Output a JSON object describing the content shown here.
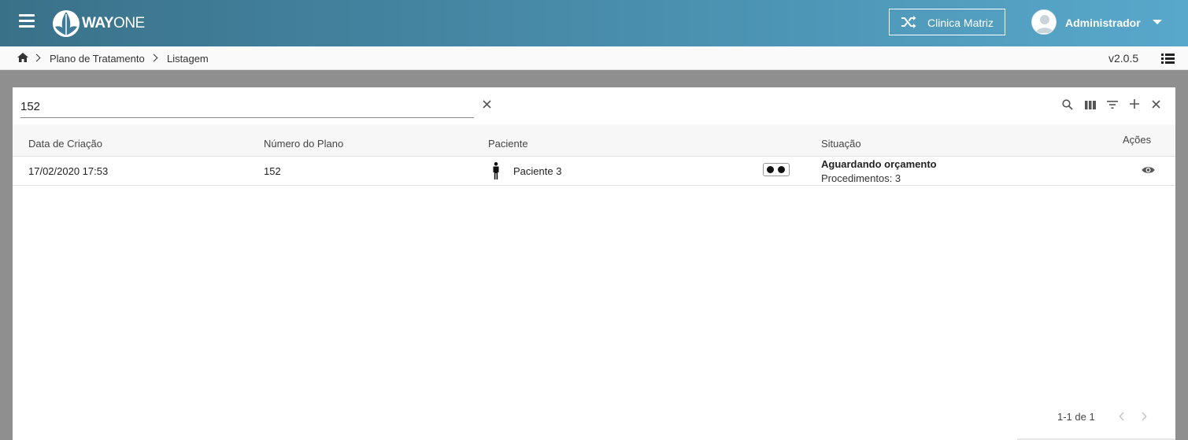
{
  "header": {
    "logo_text_bold": "WAY",
    "logo_text_light": "ONE",
    "clinic_button_label": "Clinica Matriz",
    "user_name": "Administrador"
  },
  "breadcrumb": {
    "items": [
      "Plano de Tratamento",
      "Listagem"
    ],
    "version": "v2.0.5"
  },
  "search": {
    "value": "152",
    "placeholder": ""
  },
  "table": {
    "columns": [
      "Data de Criação",
      "Número do Plano",
      "Paciente",
      "Situação",
      "Ações"
    ],
    "rows": [
      {
        "date": "17/02/2020 17:53",
        "plan_number": "152",
        "patient": "Paciente 3",
        "status": "Aguardando orçamento",
        "procedures": "Procedimentos: 3"
      }
    ]
  },
  "pagination": {
    "range_text": "1-1 de 1"
  },
  "icons": {
    "menu": "hamburger-icon",
    "clinic": "shuffle-icon",
    "home": "home-icon",
    "list": "list-view-icon",
    "clear": "close-icon",
    "toolbar": [
      "search-icon",
      "columns-icon",
      "filter-icon",
      "add-icon",
      "close-icon"
    ],
    "patient": "person-icon",
    "action": "eye-icon"
  },
  "colors": {
    "header_start": "#3a7189",
    "header_end": "#58a8cb",
    "page_bg": "#8f8f8f"
  }
}
